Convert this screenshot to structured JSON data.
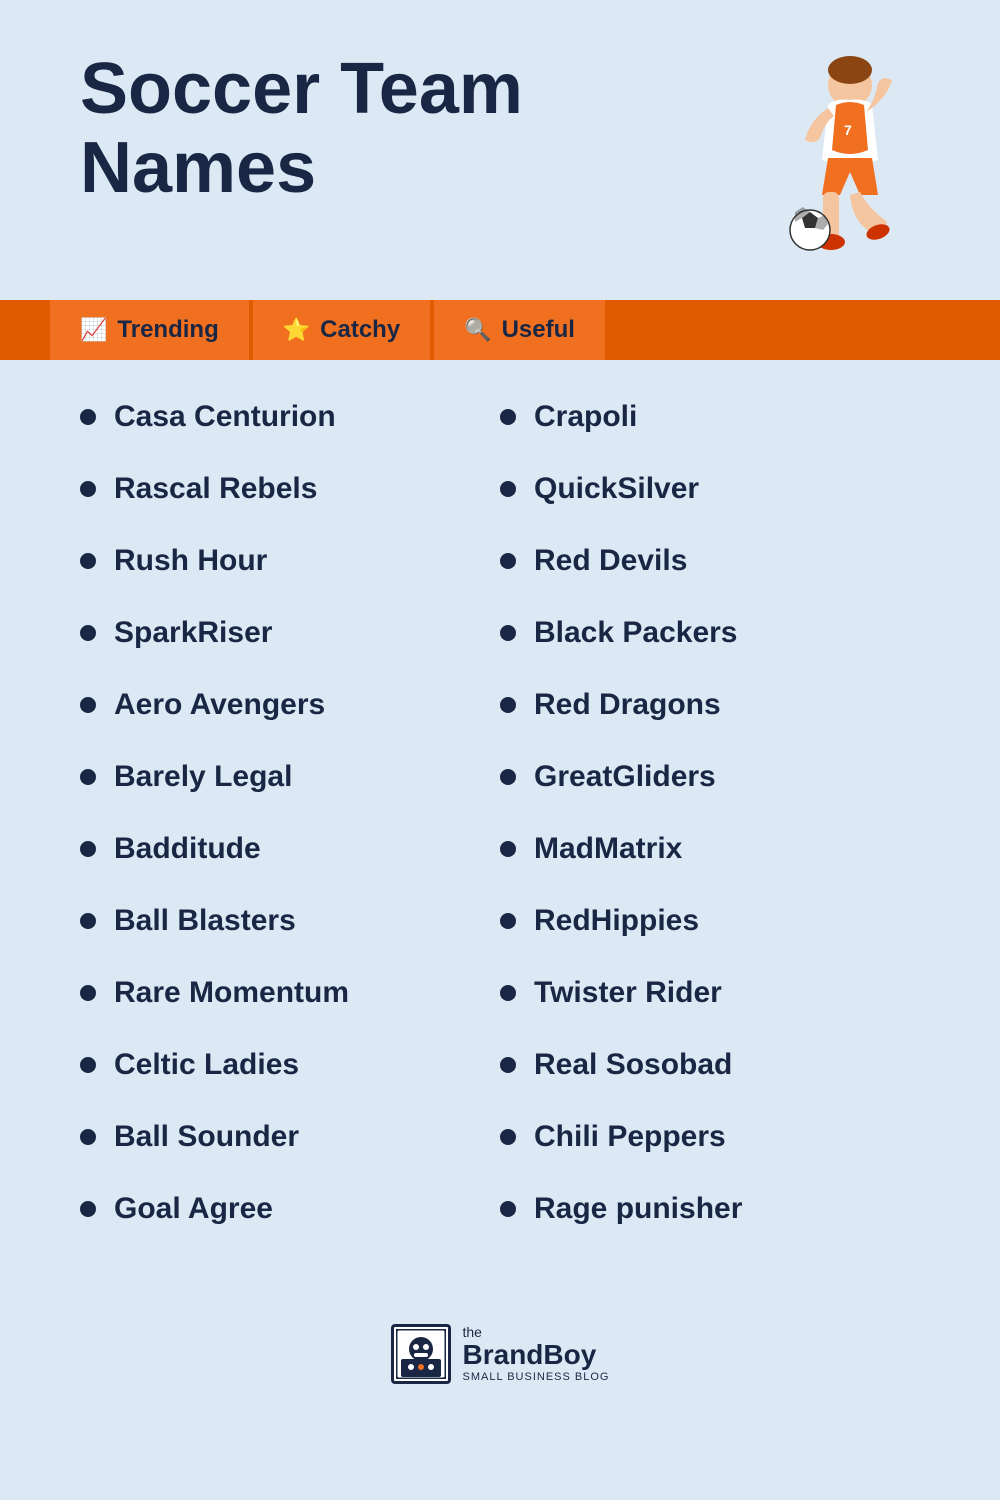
{
  "page": {
    "background_color": "#dce9f5"
  },
  "header": {
    "title_line1": "Soccer Team",
    "title_line2": "Names"
  },
  "nav": {
    "tabs": [
      {
        "label": "Trending",
        "icon": "📈"
      },
      {
        "label": "Catchy",
        "icon": "⭐"
      },
      {
        "label": "Useful",
        "icon": "🔍"
      }
    ]
  },
  "list_left": [
    "Casa Centurion",
    "Rascal Rebels",
    "Rush Hour",
    "SparkRiser",
    "Aero Avengers",
    "Barely Legal",
    "Badditude",
    "Ball Blasters",
    "Rare Momentum",
    "Celtic Ladies",
    "Ball Sounder",
    "Goal Agree"
  ],
  "list_right": [
    "Crapoli",
    "QuickSilver",
    "Red Devils",
    "Black Packers",
    "Red Dragons",
    "GreatGliders",
    "MadMatrix",
    "RedHippies",
    "Twister Rider",
    "Real Sosobad",
    "Chili Peppers",
    "Rage punisher"
  ],
  "footer": {
    "brand_the": "the",
    "brand_name": "BrandBoy",
    "brand_sub": "SMALL BUSINESS BLOG",
    "brand_icon": "🤖"
  }
}
